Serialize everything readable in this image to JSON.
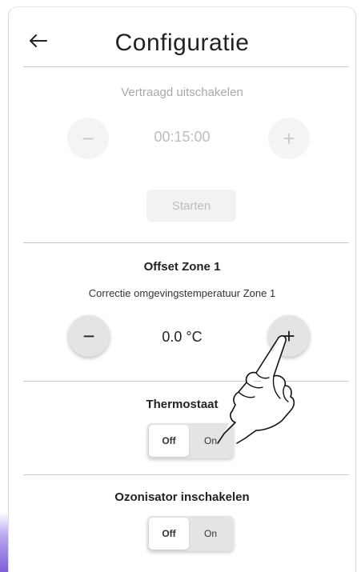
{
  "header": {
    "title": "Configuratie",
    "back_icon": "arrow-left-icon"
  },
  "delay_section": {
    "title": "Vertraagd uitschakelen",
    "value": "00:15:00",
    "minus_label": "−",
    "plus_label": "+",
    "start_label": "Starten",
    "enabled": false
  },
  "offset_section": {
    "title": "Offset Zone 1",
    "subtitle": "Correctie omgevingstemperatuur Zone 1",
    "value": "0.0 °C",
    "minus_label": "−",
    "plus_label": "+"
  },
  "thermostat_section": {
    "title": "Thermostaat",
    "off_label": "Off",
    "on_label": "On",
    "selected": "Off"
  },
  "ozonizer_section": {
    "title": "Ozonisator inschakelen",
    "off_label": "Off",
    "on_label": "On",
    "selected": "Off"
  },
  "overlay": {
    "icon": "pointing-hand-icon"
  },
  "colors": {
    "accent": "#7c5fd8",
    "button_gray": "#e4e4e4",
    "disabled_text": "#bdbdbd"
  }
}
